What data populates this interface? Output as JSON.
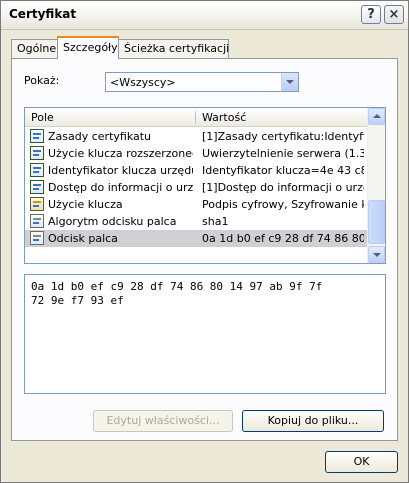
{
  "window": {
    "title": "Certyfikat"
  },
  "tabs": [
    {
      "label": "Ogólne"
    },
    {
      "label": "Szczegóły"
    },
    {
      "label": "Ścieżka certyfikacji"
    }
  ],
  "filter": {
    "label": "Pokaż:",
    "selected": "<Wszyscy>"
  },
  "list": {
    "headers": {
      "field": "Pole",
      "value": "Wartość"
    },
    "rows": [
      {
        "field": "Zasady certyfikatu",
        "value": "[1]Zasady certyfikatu:Identyfi...",
        "icon": "certificate-extension-icon"
      },
      {
        "field": "Użycie klucza rozszerzonego",
        "value": "Uwierzytelnienie serwera (1.3....",
        "icon": "certificate-extension-icon"
      },
      {
        "field": "Identyfikator klucza urzędu",
        "value": "Identyfikator klucza=4e 43 c8 ...",
        "icon": "certificate-extension-icon"
      },
      {
        "field": "Dostęp do informacji o urzę...",
        "value": "[1]Dostęp do informacji o urzę...",
        "icon": "certificate-extension-icon"
      },
      {
        "field": "Użycie klucza",
        "value": "Podpis cyfrowy, Szyfrowanie k...",
        "icon": "critical-extension-icon"
      },
      {
        "field": "Algorytm odcisku palca",
        "value": "sha1",
        "icon": "property-icon"
      },
      {
        "field": "Odcisk palca",
        "value": "0a 1d b0 ef c9 28 df 74 86 80 ...",
        "icon": "property-icon"
      }
    ],
    "scroll_position": 0.85
  },
  "detail": {
    "text": "0a 1d b0 ef c9 28 df 74 86 80 14 97 ab 9f 7f\n72 9e f7 93 ef"
  },
  "buttons": {
    "edit_properties": "Edytuj właściwości...",
    "copy_to_file": "Kopiuj do pliku...",
    "ok": "OK"
  },
  "titlebar_buttons": {
    "help": "?",
    "close": "×"
  }
}
